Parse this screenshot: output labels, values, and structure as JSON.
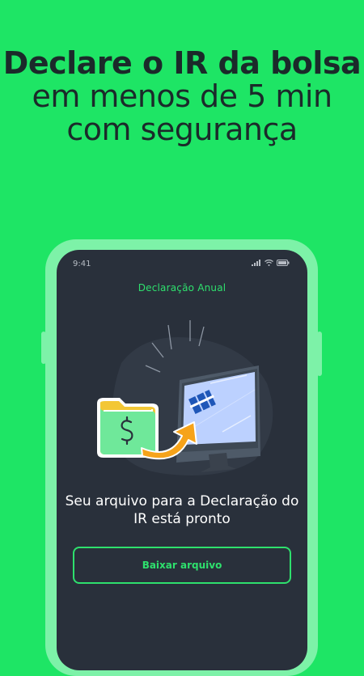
{
  "headline": {
    "bold_part": "Declare o IR da bolsa",
    "regular_part": "em menos de 5 min com segurança"
  },
  "status_bar": {
    "time": "9:41"
  },
  "screen": {
    "title": "Declaração Anual",
    "message": "Seu arquivo para a Declaração do IR está pronto",
    "download_button": "Baixar arquivo"
  },
  "icons": [
    "signal-icon",
    "wifi-icon",
    "battery-icon",
    "folder-icon",
    "dollar-icon",
    "arrow-icon",
    "monitor-icon",
    "receita-logo-icon"
  ],
  "colors": {
    "background": "#1ee565",
    "screen": "#29303b",
    "accent": "#2ee06d",
    "headline_text": "#1b2a2a"
  }
}
